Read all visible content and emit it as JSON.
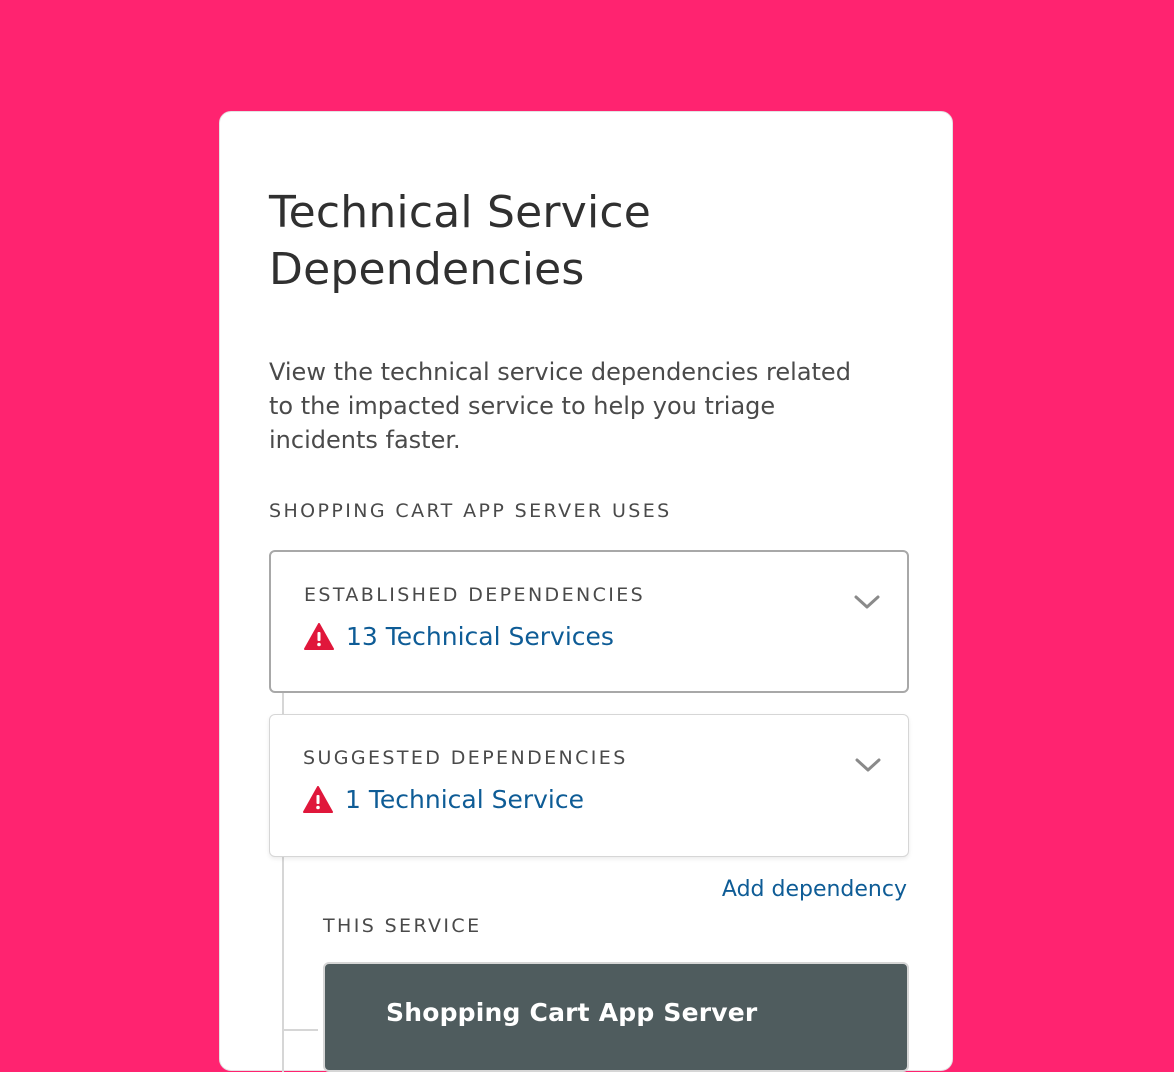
{
  "card": {
    "title": "Technical Service Dependencies",
    "description": "View the technical service dependencies related to the impacted service to help you triage incidents faster.",
    "section_label": "SHOPPING CART APP SERVER USES",
    "established": {
      "heading": "ESTABLISHED DEPENDENCIES",
      "link_text": "13 Technical Services",
      "icon": "warning-triangle-icon"
    },
    "suggested": {
      "heading": "SUGGESTED DEPENDENCIES",
      "link_text": "1 Technical Service",
      "icon": "warning-triangle-icon"
    },
    "add_dependency_label": "Add dependency",
    "this_service_label": "THIS SERVICE",
    "this_service_name": "Shopping Cart App Server"
  },
  "colors": {
    "background": "#FF2370",
    "link": "#0E5C96",
    "warning": "#E0173B",
    "service_box": "#4F5C5E"
  }
}
